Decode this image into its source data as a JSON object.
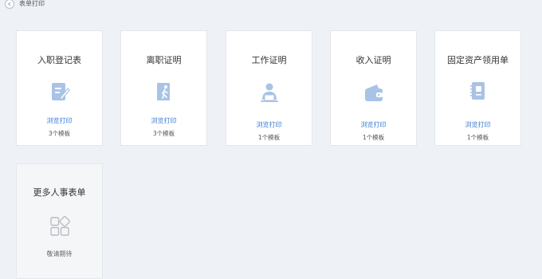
{
  "header": {
    "title": "表单打印"
  },
  "cards": [
    {
      "title": "入职登记表",
      "link": "浏览打印",
      "count": "3个模板",
      "icon": "form-edit-icon"
    },
    {
      "title": "离职证明",
      "link": "浏览打印",
      "count": "3个模板",
      "icon": "person-leaving-icon"
    },
    {
      "title": "工作证明",
      "link": "浏览打印",
      "count": "1个模板",
      "icon": "person-at-laptop-icon"
    },
    {
      "title": "收入证明",
      "link": "浏览打印",
      "count": "1个模板",
      "icon": "wallet-icon"
    },
    {
      "title": "固定资产领用单",
      "link": "浏览打印",
      "count": "1个模板",
      "icon": "notebook-icon"
    }
  ],
  "more": {
    "title": "更多人事表单",
    "status": "敬请期待",
    "icon": "grid-apps-icon"
  },
  "colors": {
    "accent": "#3a7bd5",
    "icon": "#a9c3e6",
    "background": "#eef1f5"
  }
}
